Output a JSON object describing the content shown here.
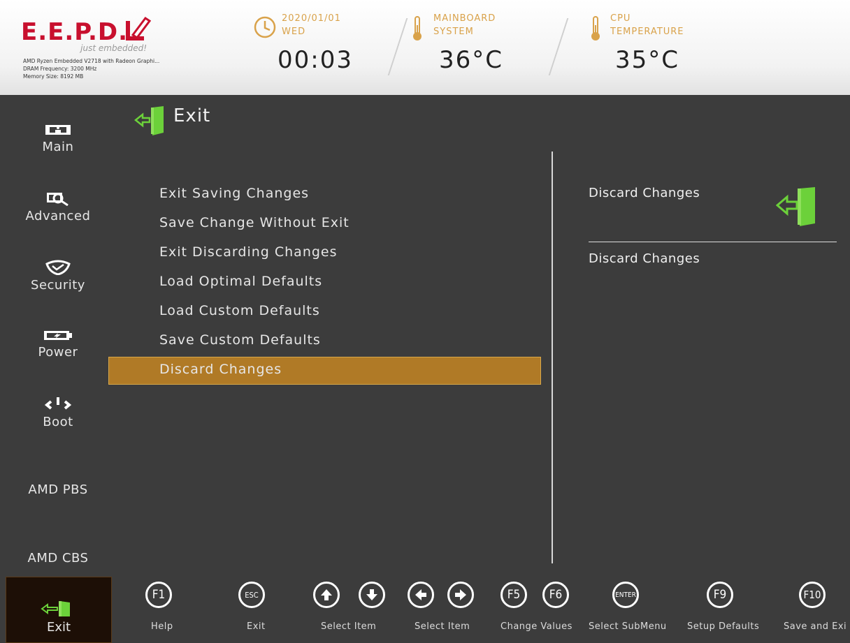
{
  "header": {
    "brand": "E.E.P.D.",
    "tagline": "just embedded!",
    "sysinfo": [
      "AMD Ryzen Embedded V2718 with Radeon Graphi...",
      "DRAM Frequency: 3200 MHz",
      "Memory Size: 8192 MB"
    ],
    "date": "2020/01/01",
    "weekday": "WED",
    "time": "00:03",
    "mainboard_label_1": "MAINBOARD",
    "mainboard_label_2": "SYSTEM",
    "mainboard_temp": "36°C",
    "cpu_label_1": "CPU",
    "cpu_label_2": "TEMPERATURE",
    "cpu_temp": "35°C"
  },
  "sidebar": {
    "items": [
      {
        "label": "Main",
        "icon": "monitor-icon"
      },
      {
        "label": "Advanced",
        "icon": "magnifier-icon"
      },
      {
        "label": "Security",
        "icon": "shield-icon"
      },
      {
        "label": "Power",
        "icon": "battery-icon"
      },
      {
        "label": "Boot",
        "icon": "power-icon"
      },
      {
        "label": "AMD PBS"
      },
      {
        "label": "AMD CBS"
      },
      {
        "label": "Exit",
        "icon": "exit-door-icon",
        "active": true
      }
    ]
  },
  "main": {
    "title": "Exit",
    "menu": [
      "Exit Saving Changes",
      "Save Change Without Exit",
      "Exit Discarding Changes",
      "Load Optimal Defaults",
      "Load Custom Defaults",
      "Save Custom Defaults",
      "Discard Changes"
    ],
    "selected_index": 6
  },
  "help": {
    "title": "Discard Changes",
    "text": "Discard Changes"
  },
  "footer": {
    "keys": [
      {
        "keys": [
          "F1"
        ],
        "label": "Help"
      },
      {
        "keys": [
          "ESC"
        ],
        "label": "Exit"
      },
      {
        "keys": [
          "up-arrow-icon",
          "down-arrow-icon"
        ],
        "label": "Select Item"
      },
      {
        "keys": [
          "left-arrow-icon",
          "right-arrow-icon"
        ],
        "label": "Select Item"
      },
      {
        "keys": [
          "F5",
          "F6"
        ],
        "label": "Change Values"
      },
      {
        "keys": [
          "ENTER"
        ],
        "label": "Select  SubMenu"
      },
      {
        "keys": [
          "F9"
        ],
        "label": "Setup Defaults"
      },
      {
        "keys": [
          "F10"
        ],
        "label": "Save and Exi"
      }
    ]
  },
  "colors": {
    "accent_orange": "#b07a26",
    "header_gold": "#d9a24a",
    "brand_red": "#c8102e",
    "exit_green": "#6cd13a"
  }
}
